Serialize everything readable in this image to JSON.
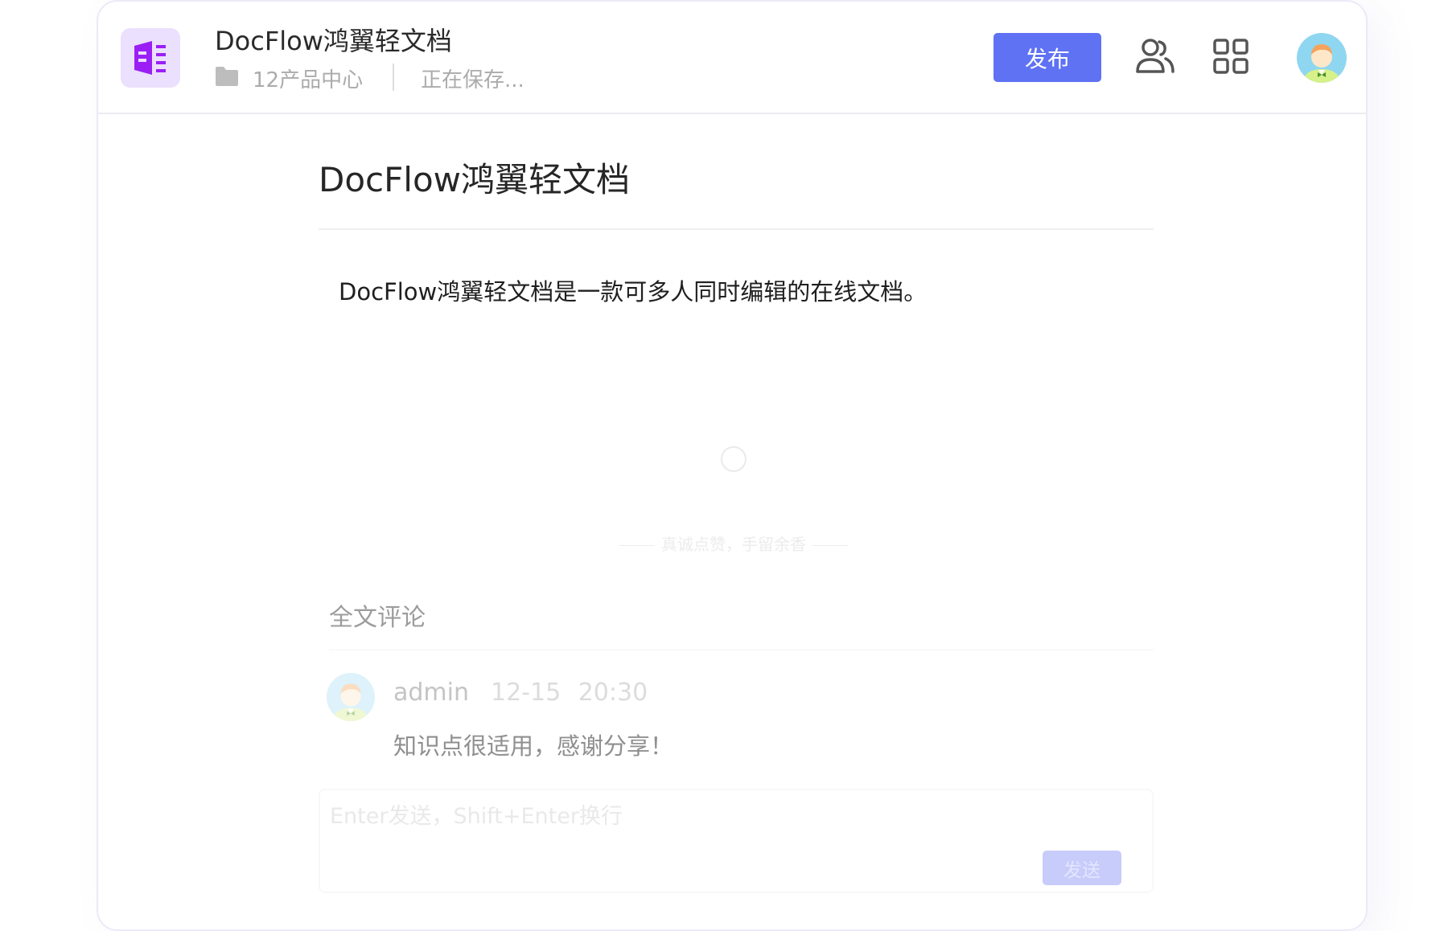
{
  "header": {
    "doc_title": "DocFlow鸿翼轻文档",
    "folder": "12产品中心",
    "save_status": "正在保存...",
    "publish_label": "发布"
  },
  "icons": {
    "app_logo": "document-app-icon",
    "folder": "folder-icon",
    "members": "members-icon",
    "apps": "apps-grid-icon",
    "avatar": "user-avatar"
  },
  "document": {
    "title": "DocFlow鸿翼轻文档",
    "paragraph": "DocFlow鸿翼轻文档是一款可多人同时编辑的在线文档。"
  },
  "like_hint": "真诚点赞，手留余香",
  "comments": {
    "heading": "全文评论",
    "items": [
      {
        "author": "admin",
        "time": "12-15 20:30",
        "text": "知识点很适用，感谢分享！"
      }
    ],
    "input_placeholder": "Enter发送，Shift+Enter换行",
    "send_label": "发送"
  },
  "colors": {
    "accent": "#5f72f3",
    "accent_disabled": "#c7ccfb",
    "logo_bg": "#ebe0fd",
    "logo_fg": "#9b1ff5"
  }
}
